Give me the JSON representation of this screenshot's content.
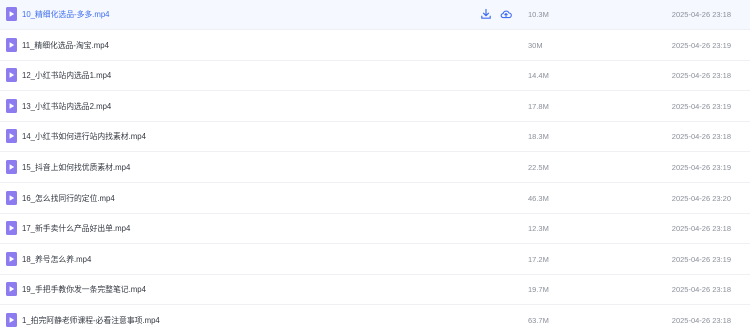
{
  "colors": {
    "accent": "#3f6ff0",
    "file_icon": "#8c7cf0",
    "hover_row": "#f5f8ff",
    "text": "#333840",
    "muted": "#8a8f99"
  },
  "hover_actions": [
    {
      "icon": "download-icon"
    },
    {
      "icon": "cloud-save-icon"
    }
  ],
  "files": [
    {
      "name": "10_精细化选品-多多.mp4",
      "size": "10.3M",
      "time": "2025-04-26 23:18"
    },
    {
      "name": "11_精细化选品-淘宝.mp4",
      "size": "30M",
      "time": "2025-04-26 23:19"
    },
    {
      "name": "12_小红书站内选品1.mp4",
      "size": "14.4M",
      "time": "2025-04-26 23:18"
    },
    {
      "name": "13_小红书站内选品2.mp4",
      "size": "17.8M",
      "time": "2025-04-26 23:19"
    },
    {
      "name": "14_小红书如何进行站内找素材.mp4",
      "size": "18.3M",
      "time": "2025-04-26 23:18"
    },
    {
      "name": "15_抖音上如何找优质素材.mp4",
      "size": "22.5M",
      "time": "2025-04-26 23:19"
    },
    {
      "name": "16_怎么找同行的定位.mp4",
      "size": "46.3M",
      "time": "2025-04-26 23:20"
    },
    {
      "name": "17_新手卖什么产品好出单.mp4",
      "size": "12.3M",
      "time": "2025-04-26 23:18"
    },
    {
      "name": "18_养号怎么养.mp4",
      "size": "17.2M",
      "time": "2025-04-26 23:19"
    },
    {
      "name": "19_手把手教你发一条完整笔记.mp4",
      "size": "19.7M",
      "time": "2025-04-26 23:18"
    },
    {
      "name": "1_拍完阿静老师课程-必看注意事项.mp4",
      "size": "63.7M",
      "time": "2025-04-26 23:18"
    }
  ]
}
